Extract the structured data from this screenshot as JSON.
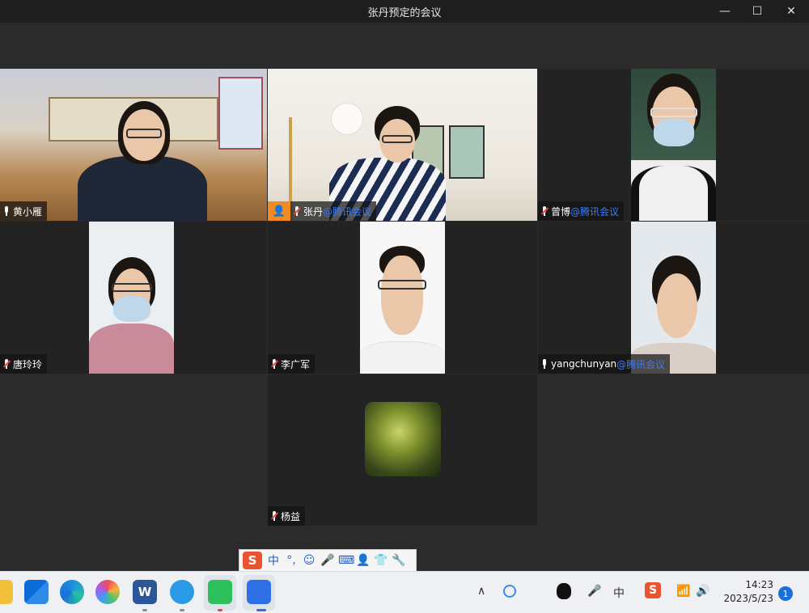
{
  "window": {
    "title": "张丹预定的会议",
    "minimize_glyph": "—",
    "maximize_glyph": "☐",
    "close_glyph": "✕"
  },
  "participants": [
    {
      "name": "黄小雁",
      "suffix": "",
      "muted": false
    },
    {
      "name": "张丹",
      "suffix": "@腾讯会议",
      "muted": true,
      "host": true
    },
    {
      "name": "曾博",
      "suffix": "@腾讯会议",
      "muted": true
    },
    {
      "name": "唐玲玲",
      "suffix": "",
      "muted": true
    },
    {
      "name": "李广军",
      "suffix": "",
      "muted": true
    },
    {
      "name": "yangchunyan",
      "suffix": "@腾讯会议",
      "muted": false
    },
    {
      "name": "杨益",
      "suffix": "",
      "muted": true
    }
  ],
  "ime": {
    "logo": "S",
    "mode": "中",
    "punct": "°,",
    "emoji": "☺",
    "voice": "🎤",
    "keyboard": "⌨",
    "user": "👤",
    "skin": "👕",
    "tools": "🔧"
  },
  "taskbar": {
    "icons": [
      "start-icon",
      "edge-icon",
      "photos-icon",
      "word-icon",
      "chat-icon",
      "wechat-icon",
      "meeting-icon"
    ],
    "word_glyph": "W",
    "tray_up": "∧",
    "tray_ime": "中",
    "tray_sogou": "S",
    "time": "14:23",
    "date": "2023/5/23",
    "notifications": "1"
  }
}
